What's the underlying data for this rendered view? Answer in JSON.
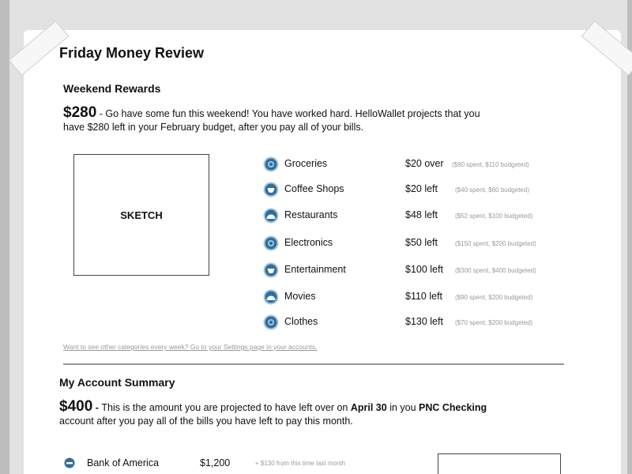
{
  "page": {
    "title": "Friday Money Review"
  },
  "rewards": {
    "heading": "Weekend Rewards",
    "amount": "$280",
    "text_line1": "- Go have some fun this weekend!  You have worked hard.  HelloWallet projects that you",
    "text_line2": "have $280 left in your February budget, after you pay all of your bills.",
    "sketch_label": "SKETCH",
    "categories": [
      {
        "name": "Groceries",
        "amount": "$20 over",
        "detail": "($90 spent, $110 budgeted)",
        "icon": "target-icon"
      },
      {
        "name": "Coffee Shops",
        "amount": "$20 left",
        "detail": "($40 spent, $60 budgeted)",
        "icon": "coffee-cup-icon"
      },
      {
        "name": "Restaurants",
        "amount": "$48 left",
        "detail": "($52 spent, $100 budgeted)",
        "icon": "dome-icon"
      },
      {
        "name": "Electronics",
        "amount": "$50 left",
        "detail": "($150 spent, $200 budgeted)",
        "icon": "target-icon"
      },
      {
        "name": "Entertainment",
        "amount": "$100 left",
        "detail": "($300 spent, $400 budgeted)",
        "icon": "coffee-cup-icon"
      },
      {
        "name": "Movies",
        "amount": "$110 left",
        "detail": "($90 spent, $200 budgeted)",
        "icon": "dome-icon"
      },
      {
        "name": "Clothes",
        "amount": "$130 left",
        "detail": "($70 spent, $200 budgeted)",
        "icon": "target-icon"
      }
    ],
    "settings_link": "Want to see other categories every week?  Go to your Settings page in your accounts."
  },
  "summary": {
    "heading": "My Account Summary",
    "amount": "$400",
    "text_a": " - ",
    "text_b": "This is the amount you are projected to have left over on ",
    "date": "April 30",
    "text_c": " in you ",
    "account": "PNC Checking",
    "text_line2": "account after you pay all of the bills you have left to pay this month.",
    "accounts": [
      {
        "name": "Bank of America",
        "balance": "$1,200",
        "change": "+ $130",
        "change_text": " from this time last month",
        "icon": "bank-icon"
      }
    ]
  },
  "colors": {
    "icon_blue": "#2f6f9f",
    "icon_light": "#a9c7dd",
    "muted": "#999999"
  }
}
